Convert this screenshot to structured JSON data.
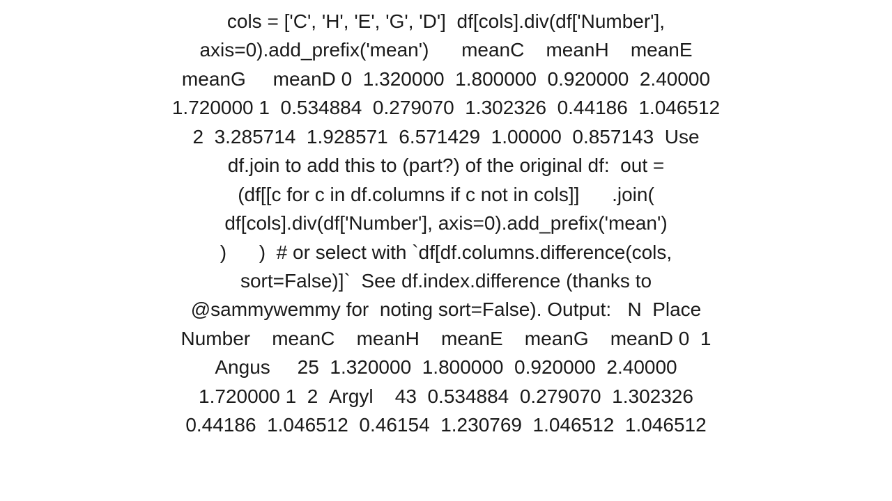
{
  "content": {
    "lines": [
      "cols = ['C', 'H', 'E', 'G', 'D']  df[cols].div(df['Number'],",
      "axis=0).add_prefix('mean')      meanC    meanH    meanE",
      "meanG     meanD 0  1.320000  1.800000  0.920000  2.40000",
      "1.720000 1  0.534884  0.279070  1.302326  0.44186  1.046512",
      "2  3.285714  1.928571  6.571429  1.00000  0.857143  Use",
      "df.join to add this to (part?) of the original df:  out =",
      "(df[[c for c in df.columns if c not in cols]]      .join(",
      "df[cols].div(df['Number'], axis=0).add_prefix('mean')",
      ")       )  # or select with `df[df.columns.difference(cols,",
      "sort=False)]`  See df.index.difference (thanks to",
      "@sammywemmy for  noting sort=False). Output:   N  Place",
      "Number    meanC    meanH    meanE    meanG    meanD 0  1",
      "Angus     25  1.320000  1.800000  0.920000  2.40000",
      "1.720000 1  2  Argyl    43  0.534884  0.279070  1.302326",
      "0.44186  1.046512  0.46154  1.230769  1.046512  1.046512"
    ]
  }
}
